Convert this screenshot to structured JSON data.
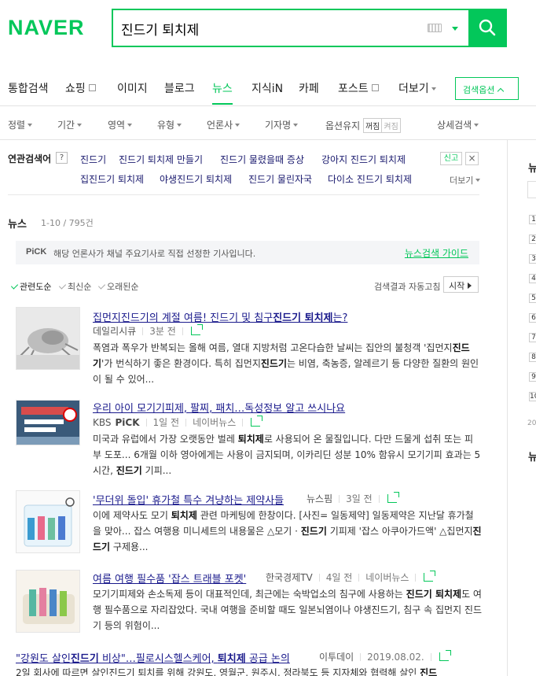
{
  "header": {
    "logo": "NAVER",
    "search_value": "진드기 퇴치제"
  },
  "tabs": [
    {
      "label": "통합검색"
    },
    {
      "label": "쇼핑",
      "external": true
    },
    {
      "label": "이미지"
    },
    {
      "label": "블로그"
    },
    {
      "label": "뉴스",
      "active": true
    },
    {
      "label": "지식iN"
    },
    {
      "label": "카페"
    },
    {
      "label": "포스트",
      "external": true
    },
    {
      "label": "더보기"
    }
  ],
  "search_options_label": "검색옵션",
  "filters": [
    "정렬",
    "기간",
    "영역",
    "유형",
    "언론사",
    "기자명"
  ],
  "option_keep": {
    "label": "옵션유지",
    "on": "꺼짐",
    "off": "켜짐"
  },
  "detail_search": "상세검색",
  "related": {
    "label": "연관검색어",
    "help": "?",
    "row1": [
      "진드기",
      "진드기 퇴치제 만들기",
      "진드기 물렸을때 증상",
      "강아지 진드기 퇴치제"
    ],
    "row2": [
      "집진드기 퇴치제",
      "야생진드기 퇴치제",
      "진드기 물린자국",
      "다이소 진드기 퇴치제"
    ],
    "report": "신고",
    "close": "×",
    "more": "더보기"
  },
  "news": {
    "title": "뉴스",
    "count": "1-10 / 795건",
    "pick_logo": "PiCK",
    "pick_text": "해당 언론사가 채널 주요기사로 직접 선정한 기사입니다.",
    "pick_guide": "뉴스검색 가이드",
    "sort": [
      "관련도순",
      "최신순",
      "오래된순"
    ],
    "autorefresh": "검색결과 자동고침",
    "start": "시작"
  },
  "articles": [
    {
      "title_html": "집먼지진드기의 계절 여름! 진드기 및 침구<b>진드기 퇴치제</b>는?",
      "source": "데일리시큐",
      "time": "3분 전",
      "extra": "",
      "desc_html": "폭염과 폭우가 반복되는 올해 여름, 열대 지방처럼 고온다습한 날씨는 집안의 불청객 '집먼지<b>진드기</b>'가 번식하기 좋은 환경이다. 특히 집먼지<b>진드기</b>는 비염, 축농증, 알레르기 등 다양한 질환의 원인이 될 수 있어..."
    },
    {
      "title_html": "우리 아이 모기기피제, 팔찌, 패치…독성정보 알고 쓰시나요",
      "source": "KBS",
      "pick": "PiCK",
      "time": "1일 전",
      "extra": "네이버뉴스",
      "desc_html": "미국과 유럽에서 가장 오랫동안 벌레 <b>퇴치제</b>로 사용되어 온 물질입니다. 다만 드물게 섭취 또는 피부 도포... 6개월 이하 영아에게는 사용이 금지되며, 이카리딘 성분 10% 함유시 모기기피 효과는 5시간, <b>진드기</b> 기피..."
    },
    {
      "title_html": "'무더위 돌입' 휴가철 특수 겨냥하는 제약사들",
      "source": "뉴스핌",
      "time": "3일 전",
      "extra": "",
      "desc_html": "이에 제약사도 모기 <b>퇴치제</b> 관련 마케팅에 한창이다. [사진= 일동제약] 일동제약은 지난달 휴가철을 맞아... 잡스 여행용 미니세트의 내용물은 △모기 · <b>진드기</b> 기피제 '잡스 아쿠아가드액' △집먼지<b>진드기</b> 구제용..."
    },
    {
      "title_html": "여름 여행 필수품 '잡스 트래블 포켓'",
      "source": "한국경제TV",
      "time": "4일 전",
      "extra": "네이버뉴스",
      "desc_html": "모기기피제와 손소독제 등이 대표적인데, 최근에는 숙박업소의 침구에 사용하는 <b>진드기 퇴치제</b>도 여행 필수품으로 자리잡았다. 국내 여행을 준비할 때도 일본뇌염이나 야생진드기, 침구 속 집먼지 진드기 등의 위험이..."
    },
    {
      "title_html": "\"강원도 살인<b>진드기</b> 비상\"…필로시스헬스케어, <b>퇴치제</b> 공급 논의",
      "source": "이투데이",
      "time": "2019.08.02.",
      "extra": "",
      "desc_html": "2일 회사에 따르면 살인진드기 퇴치를 위해 강원도, 영월군, 원주시, 정라북도 등 지자체와 협력해 살인 <b>진드</b>"
    }
  ],
  "right_rail": {
    "title": "뉴",
    "numbers": [
      "1",
      "2",
      "3",
      "4",
      "5",
      "6",
      "7",
      "8",
      "9",
      "10"
    ],
    "footer": "20",
    "bottom": "뉴"
  },
  "colors": {
    "brand": "#03c75a",
    "link": "#1a1a8c"
  }
}
